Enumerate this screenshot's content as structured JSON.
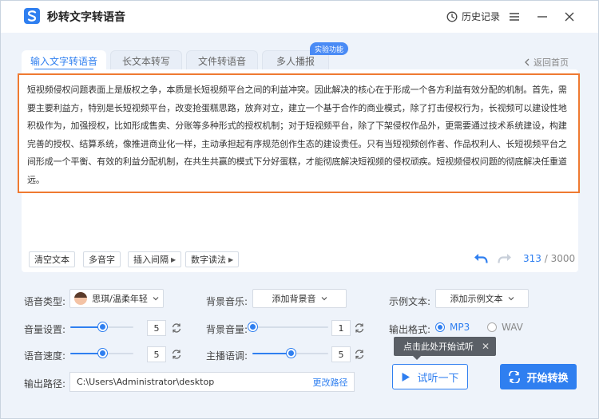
{
  "app": {
    "title": "秒转文字转语音"
  },
  "titlebar": {
    "history": "历史记录"
  },
  "tabs": [
    {
      "label": "输入文字转语音",
      "active": true
    },
    {
      "label": "长文本转写",
      "active": false
    },
    {
      "label": "文件转语音",
      "active": false
    },
    {
      "label": "多人播报",
      "active": false
    }
  ],
  "badge": "实验功能",
  "back": "返回首页",
  "editor": {
    "text": "短视频侵权问题表面上是版权之争，本质是长短视频平台之间的利益冲突。因此解决的核心在于形成一个各方利益有效分配的机制。首先，需要主要利益方，特别是长短视频平台，改变抢蛋糕思路，放弃对立，建立一个基于合作的商业模式，除了打击侵权行为，长视频可以建设性地积极作为，加强授权，比如形成售卖、分账等多种形式的授权机制；对于短视频平台，除了下架侵权作品外，更需要通过技术系统建设，构建完善的授权、结算系统，像推进商业化一样，主动承担起有序规范创作生态的建设责任。只有当短视频创作者、作品权利人、长短视频平台之间形成一个平衡、有效的利益分配机制，在共生共赢的模式下分好蛋糕，才能彻底解决短视频的侵权顽疾。短视频侵权问题的彻底解决任重道远。"
  },
  "toolbar": {
    "clear": "清空文本",
    "polyphone": "多音字",
    "insert_pause": "插入间隔",
    "number_reading": "数字读法",
    "count_current": "313",
    "count_sep": " / ",
    "count_max": "3000"
  },
  "settings": {
    "voice_type_label": "语音类型:",
    "voice_type_value": "思琪/温柔年轻",
    "bg_music_label": "背景音乐:",
    "bg_music_value": "添加背景音",
    "sample_text_label": "示例文本:",
    "sample_text_value": "添加示例文本",
    "volume_label": "音量设置:",
    "volume_value": "5",
    "volume_level": 0.5,
    "bg_volume_label": "背景音量:",
    "bg_volume_value": "1",
    "bg_volume_level": 0.0,
    "speed_label": "语音速度:",
    "speed_value": "5",
    "speed_level": 0.5,
    "pitch_label": "主播语调:",
    "pitch_value": "5",
    "pitch_level": 0.5,
    "format_label": "输出格式:",
    "format_options": [
      "MP3",
      "WAV"
    ],
    "format_selected": "MP3",
    "path_label": "输出路径:",
    "path_value": "C:\\Users\\Administrator\\desktop",
    "change_path": "更改路径"
  },
  "tooltip": {
    "text": "点击此处开始试听",
    "close": "✕"
  },
  "actions": {
    "listen": "试听一下",
    "start": "开始转换"
  },
  "colors": {
    "accent": "#2f7ff0",
    "highlight_border": "#ef7a31"
  }
}
